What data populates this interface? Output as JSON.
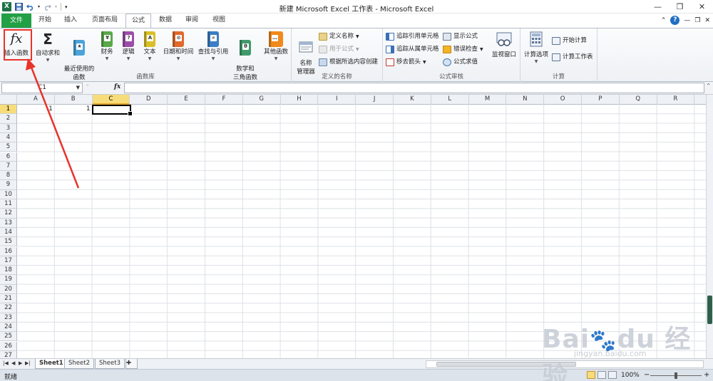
{
  "window": {
    "title": "新建 Microsoft Excel 工作表 - Microsoft Excel",
    "logo": "X"
  },
  "tabs": [
    "文件",
    "开始",
    "插入",
    "页面布局",
    "公式",
    "数据",
    "审阅",
    "视图"
  ],
  "active_tab": "公式",
  "ribbon": {
    "function_library": {
      "label": "函数库",
      "buttons": [
        {
          "label": "插入函数",
          "icon": "fx-icon"
        },
        {
          "label": "自动求和",
          "icon": "sigma-icon"
        },
        {
          "label": "最近使用的\n函数",
          "icon": "recent-functions-icon"
        },
        {
          "label": "财务",
          "icon": "financial-book-icon"
        },
        {
          "label": "逻辑",
          "icon": "logical-book-icon"
        },
        {
          "label": "文本",
          "icon": "text-book-icon"
        },
        {
          "label": "日期和时间",
          "icon": "datetime-book-icon"
        },
        {
          "label": "查找与引用",
          "icon": "lookup-book-icon"
        },
        {
          "label": "数学和\n三角函数",
          "icon": "math-book-icon"
        },
        {
          "label": "其他函数",
          "icon": "more-functions-icon"
        }
      ]
    },
    "defined_names": {
      "label": "定义的名称",
      "name_manager": "名称\n管理器",
      "define_name": "定义名称",
      "use_in_formula": "用于公式",
      "create_from_selection": "根据所选内容创建"
    },
    "formula_auditing": {
      "label": "公式审核",
      "trace_precedents": "追踪引用单元格",
      "trace_dependents": "追踪从属单元格",
      "remove_arrows": "移去箭头",
      "show_formulas": "显示公式",
      "error_checking": "错误检查",
      "evaluate_formula": "公式求值",
      "watch_window": "监视窗口"
    },
    "calculation": {
      "label": "计算",
      "calc_options": "计算选项",
      "calc_now": "开始计算",
      "calc_sheet": "计算工作表"
    }
  },
  "formula_bar": {
    "name_box": "C1",
    "fx": "fx",
    "formula": ""
  },
  "grid": {
    "columns": [
      "A",
      "B",
      "C",
      "D",
      "E",
      "F",
      "G",
      "H",
      "I",
      "J",
      "K",
      "L",
      "M",
      "N",
      "O",
      "P",
      "Q",
      "R"
    ],
    "rows": [
      "1",
      "2",
      "3",
      "4",
      "5",
      "6",
      "7",
      "8",
      "9",
      "10",
      "11",
      "12",
      "13",
      "14",
      "15",
      "16",
      "17",
      "18",
      "19",
      "20",
      "21",
      "22",
      "23",
      "24",
      "25",
      "26",
      "27"
    ],
    "selected_column": "C",
    "selected_row": "1",
    "cells": {
      "A1": "1",
      "B1": "1"
    }
  },
  "sheets": [
    "Sheet1",
    "Sheet2",
    "Sheet3"
  ],
  "active_sheet": "Sheet1",
  "status": {
    "text": "就绪",
    "zoom": "100%"
  },
  "watermark": {
    "text": "Bai 经验",
    "url": "jingyan.baidu.com"
  },
  "colors": {
    "file_tab": "#21a045",
    "callout_red": "#e8332a",
    "selection": "#f7dc7a"
  }
}
